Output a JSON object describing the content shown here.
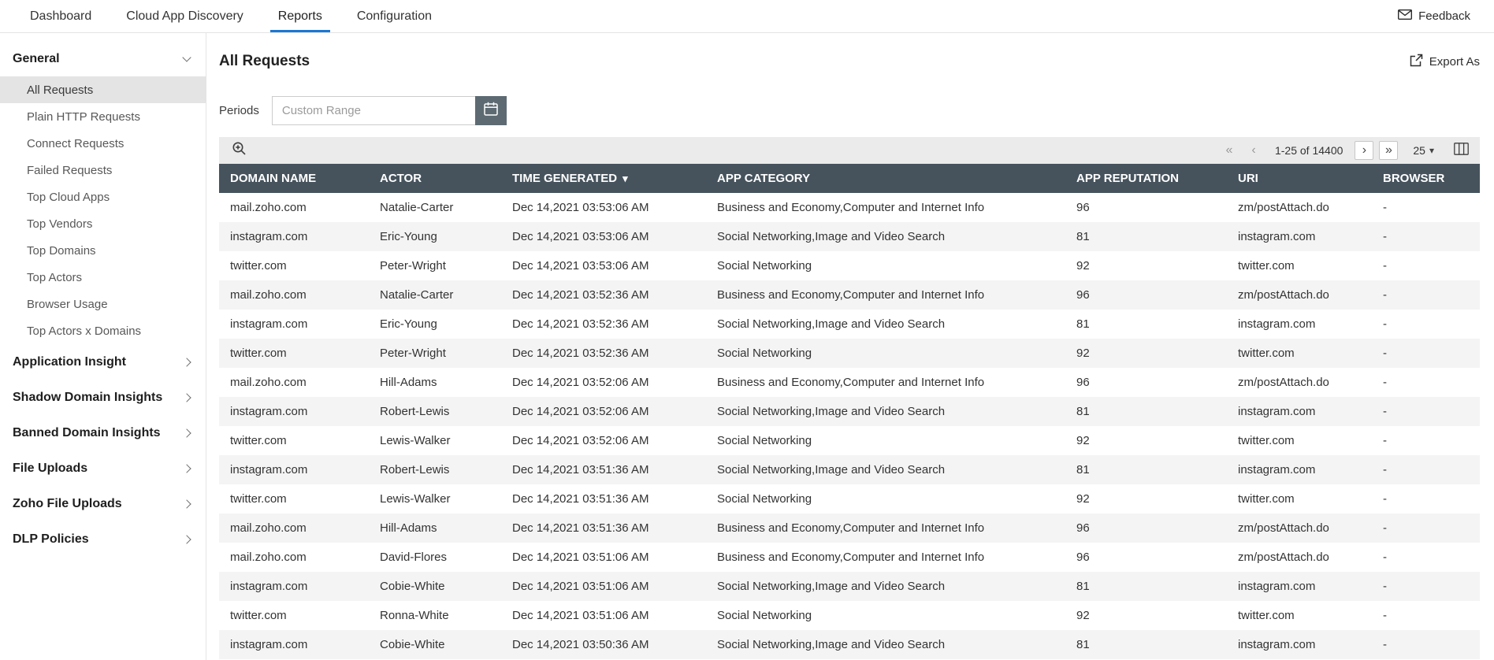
{
  "colors": {
    "accent_blue": "#1c77d4",
    "table_header_bg": "#46535d",
    "toolbar_bg": "#ebebeb",
    "calendar_button_bg": "#5d6a72",
    "selected_item_bg": "#e4e4e4",
    "row_alt_bg": "#f4f4f4"
  },
  "topnav": {
    "tabs": [
      {
        "label": "Dashboard",
        "active": false
      },
      {
        "label": "Cloud App Discovery",
        "active": false
      },
      {
        "label": "Reports",
        "active": true
      },
      {
        "label": "Configuration",
        "active": false
      }
    ],
    "feedback_label": "Feedback"
  },
  "sidebar": {
    "sections": [
      {
        "label": "General",
        "expanded": true,
        "items": [
          {
            "label": "All Requests",
            "active": true
          },
          {
            "label": "Plain HTTP Requests",
            "active": false
          },
          {
            "label": "Connect Requests",
            "active": false
          },
          {
            "label": "Failed Requests",
            "active": false
          },
          {
            "label": "Top Cloud Apps",
            "active": false
          },
          {
            "label": "Top Vendors",
            "active": false
          },
          {
            "label": "Top Domains",
            "active": false
          },
          {
            "label": "Top Actors",
            "active": false
          },
          {
            "label": "Browser Usage",
            "active": false
          },
          {
            "label": "Top Actors x Domains",
            "active": false
          }
        ]
      },
      {
        "label": "Application Insight",
        "expanded": false
      },
      {
        "label": "Shadow Domain Insights",
        "expanded": false
      },
      {
        "label": "Banned Domain Insights",
        "expanded": false
      },
      {
        "label": "File Uploads",
        "expanded": false
      },
      {
        "label": "Zoho File Uploads",
        "expanded": false
      },
      {
        "label": "DLP Policies",
        "expanded": false
      }
    ]
  },
  "main": {
    "title": "All Requests",
    "export_label": "Export As",
    "periods_label": "Periods",
    "period_placeholder": "Custom Range",
    "pagination": {
      "range": "1-25 of 14400",
      "page_size": "25"
    },
    "table": {
      "columns": [
        "DOMAIN NAME",
        "ACTOR",
        "TIME GENERATED",
        "APP CATEGORY",
        "APP REPUTATION",
        "URI",
        "BROWSER"
      ],
      "sort_column": "TIME GENERATED",
      "sort_direction": "desc",
      "rows": [
        [
          "mail.zoho.com",
          "Natalie-Carter",
          "Dec 14,2021 03:53:06 AM",
          "Business and Economy,Computer and Internet Info",
          "96",
          "zm/postAttach.do",
          "-"
        ],
        [
          "instagram.com",
          "Eric-Young",
          "Dec 14,2021 03:53:06 AM",
          "Social Networking,Image and Video Search",
          "81",
          "instagram.com",
          "-"
        ],
        [
          "twitter.com",
          "Peter-Wright",
          "Dec 14,2021 03:53:06 AM",
          "Social Networking",
          "92",
          "twitter.com",
          "-"
        ],
        [
          "mail.zoho.com",
          "Natalie-Carter",
          "Dec 14,2021 03:52:36 AM",
          "Business and Economy,Computer and Internet Info",
          "96",
          "zm/postAttach.do",
          "-"
        ],
        [
          "instagram.com",
          "Eric-Young",
          "Dec 14,2021 03:52:36 AM",
          "Social Networking,Image and Video Search",
          "81",
          "instagram.com",
          "-"
        ],
        [
          "twitter.com",
          "Peter-Wright",
          "Dec 14,2021 03:52:36 AM",
          "Social Networking",
          "92",
          "twitter.com",
          "-"
        ],
        [
          "mail.zoho.com",
          "Hill-Adams",
          "Dec 14,2021 03:52:06 AM",
          "Business and Economy,Computer and Internet Info",
          "96",
          "zm/postAttach.do",
          "-"
        ],
        [
          "instagram.com",
          "Robert-Lewis",
          "Dec 14,2021 03:52:06 AM",
          "Social Networking,Image and Video Search",
          "81",
          "instagram.com",
          "-"
        ],
        [
          "twitter.com",
          "Lewis-Walker",
          "Dec 14,2021 03:52:06 AM",
          "Social Networking",
          "92",
          "twitter.com",
          "-"
        ],
        [
          "instagram.com",
          "Robert-Lewis",
          "Dec 14,2021 03:51:36 AM",
          "Social Networking,Image and Video Search",
          "81",
          "instagram.com",
          "-"
        ],
        [
          "twitter.com",
          "Lewis-Walker",
          "Dec 14,2021 03:51:36 AM",
          "Social Networking",
          "92",
          "twitter.com",
          "-"
        ],
        [
          "mail.zoho.com",
          "Hill-Adams",
          "Dec 14,2021 03:51:36 AM",
          "Business and Economy,Computer and Internet Info",
          "96",
          "zm/postAttach.do",
          "-"
        ],
        [
          "mail.zoho.com",
          "David-Flores",
          "Dec 14,2021 03:51:06 AM",
          "Business and Economy,Computer and Internet Info",
          "96",
          "zm/postAttach.do",
          "-"
        ],
        [
          "instagram.com",
          "Cobie-White",
          "Dec 14,2021 03:51:06 AM",
          "Social Networking,Image and Video Search",
          "81",
          "instagram.com",
          "-"
        ],
        [
          "twitter.com",
          "Ronna-White",
          "Dec 14,2021 03:51:06 AM",
          "Social Networking",
          "92",
          "twitter.com",
          "-"
        ],
        [
          "instagram.com",
          "Cobie-White",
          "Dec 14,2021 03:50:36 AM",
          "Social Networking,Image and Video Search",
          "81",
          "instagram.com",
          "-"
        ]
      ]
    }
  },
  "icons": {
    "first_page": "«",
    "prev_page": "‹",
    "next_page": "›",
    "last_page": "»",
    "caret_down": "▾",
    "sort_desc": "▾"
  }
}
